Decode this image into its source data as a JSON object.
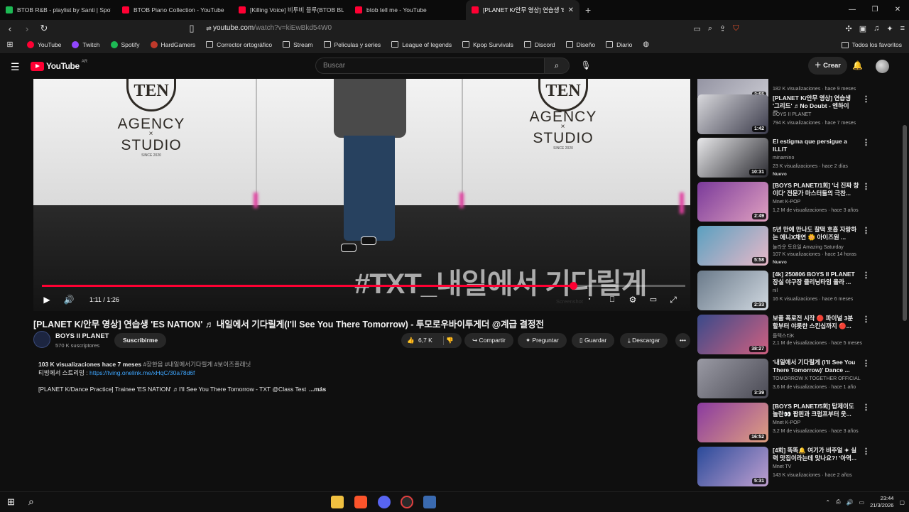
{
  "browser": {
    "tabs": [
      {
        "title": "BTOB R&B - playlist by Santi | Spotify",
        "color": "#1db954",
        "active": false
      },
      {
        "title": "BTOB Piano Collection - YouTube",
        "color": "#ff0033",
        "active": false
      },
      {
        "title": "[Killing Voice] 비투비 블루(BTOB BLU",
        "color": "#ff0033",
        "active": false
      },
      {
        "title": "btob tell me - YouTube",
        "color": "#ff0033",
        "active": false
      },
      {
        "title": "[PLANET K/안무 영상] 연습생 'ES",
        "color": "#ff0033",
        "active": true
      }
    ],
    "tab_close": "✕",
    "new_tab": "+",
    "window_controls": [
      "—",
      "❐",
      "✕"
    ],
    "url_host": "youtube.com",
    "url_path": "/watch?v=kiEwBkd54W0",
    "bookmarks": [
      {
        "label": "YouTube",
        "icon": "youtube-icon",
        "color": "#ff0033"
      },
      {
        "label": "Twitch",
        "icon": "twitch-icon",
        "color": "#9146ff"
      },
      {
        "label": "Spotify",
        "icon": "spotify-icon",
        "color": "#1db954"
      },
      {
        "label": "HardGamers",
        "icon": "hardgamers-icon",
        "color": "#c0392b"
      },
      {
        "label": "Corrector ortográfico",
        "icon": "spellcheck-icon",
        "color": ""
      },
      {
        "label": "Stream",
        "icon": "folder-icon",
        "color": ""
      },
      {
        "label": "Peliculas y series",
        "icon": "folder-icon",
        "color": ""
      },
      {
        "label": "League of legends",
        "icon": "folder-icon",
        "color": ""
      },
      {
        "label": "Kpop Survivals",
        "icon": "folder-icon",
        "color": ""
      },
      {
        "label": "Discord",
        "icon": "folder-icon",
        "color": ""
      },
      {
        "label": "Diseño",
        "icon": "folder-icon",
        "color": ""
      },
      {
        "label": "Diario",
        "icon": "folder-icon",
        "color": ""
      }
    ],
    "bookmarks_right": "Todos los favoritos"
  },
  "youtube": {
    "logo": "YouTube",
    "region": "AR",
    "search_placeholder": "Buscar",
    "create_label": "Crear",
    "accent": "#ff0033"
  },
  "player": {
    "wall_logo_top": "TEN",
    "wall_logo_mid": "AGENCY",
    "wall_logo_x": "×",
    "wall_logo_bottom": "STUDIO",
    "wall_logo_since": "SINCE 2020",
    "overlay_text": "#TXT_내일에서 기다릴게",
    "time": "1:11 / 1:26",
    "progress_fraction": 0.826,
    "screenshot_label": "Screenshot"
  },
  "video": {
    "title": "[PLANET K/안무 영상] 연습생 'ES NATION' ♬ 내일에서 기다릴게(I'll See You There Tomorrow) - 투모로우바이투게더 @계급 결정전",
    "channel": "BOYS II PLANET",
    "subscribers": "570 K suscriptores",
    "subscribe": "Suscribirme",
    "likes": "6,7 K",
    "share": "Compartir",
    "ask": "Preguntar",
    "save": "Guardar",
    "download": "Descargar",
    "desc_stats": "103 K visualizaciones  hace 7 meses",
    "desc_tags": "#장한음 #내일에서기다릴게 #보이즈플래닛",
    "desc_stream": "티빙에서 스트리밍 : ",
    "desc_link": "https://tving.onelink.me/xHqC/30a78d6f",
    "desc_line3": "[PLANET K/Dance Practice] Trainee 'ES NATION' ♬I'll See You There Tomorrow - TXT @Class Test",
    "desc_more": "...más"
  },
  "recommendations": [
    {
      "title": "",
      "channel": "",
      "views": "182 K visualizaciones · hace 9 meses",
      "duration": "2:55",
      "badge": "",
      "thumb": [
        "#8a8a9a",
        "#c8c8d0"
      ]
    },
    {
      "title": "[PLANET K/안무 영상] 연습생 '그리드' ♬No Doubt - 엔하이픈...",
      "channel": "BOYS II PLANET",
      "views": "794 K visualizaciones · hace 7 meses",
      "duration": "1:42",
      "badge": "",
      "thumb": [
        "#d8d8dc",
        "#3a3a4a"
      ]
    },
    {
      "title": "El estigma que persigue a ILLIT",
      "channel": "minamino",
      "views": "23 K visualizaciones · hace 2 días",
      "duration": "10:31",
      "badge": "Nuevo",
      "thumb": [
        "#e8e8ea",
        "#2a2a30"
      ]
    },
    {
      "title": "[BOYS PLANET/1회] '너 진짜 창이다' 전문가 마스터들의 극찬...",
      "channel": "Mnet K-POP",
      "views": "1,2 M de visualizaciones · hace 3 años",
      "duration": "2:49",
      "badge": "",
      "thumb": [
        "#7a3a9a",
        "#e0a0c0"
      ]
    },
    {
      "title": "5년 만에 만나도 찰떡 호흡 자랑하는 에니X채연 🌼 아이즈원 ...",
      "channel": "놀라운 토요일 Amazing Saturday",
      "views": "107 K visualizaciones · hace 14 horas",
      "duration": "5:58",
      "badge": "Nuevo",
      "thumb": [
        "#5aa0c0",
        "#e8b8c8"
      ]
    },
    {
      "title": "[4k] 250806 BOYS II PLANET 장실 야구장 클리닝타임 올라 ...",
      "channel": "nil",
      "views": "16 K visualizaciones · hace 6 meses",
      "duration": "2:33",
      "badge": "",
      "thumb": [
        "#6a7a8a",
        "#d0d8e0"
      ]
    },
    {
      "title": "보플 폭로전 시작 🔴 파이널 3분 할부터 야릇한 스킨십까지 🔴...",
      "channel": "돌텍스타K",
      "views": "2,1 M de visualizaciones · hace 5 meses",
      "duration": "38:27",
      "badge": "",
      "thumb": [
        "#3a4a8a",
        "#d06080"
      ]
    },
    {
      "title": "'내일에서 기다릴게 (I'll See You There Tomorrow)' Dance ...",
      "channel": "TOMORROW X TOGETHER OFFICIAL",
      "views": "3,6 M de visualizaciones · hace 1 año",
      "duration": "3:39",
      "badge": "",
      "thumb": [
        "#9a9aa4",
        "#4a4a54"
      ]
    },
    {
      "title": "[BOYS PLANET/5회] 탑제이도 놀란👀 팝핀과 크럼프부터 웃...",
      "channel": "Mnet K-POP",
      "views": "3,2 M de visualizaciones · hace 3 años",
      "duration": "16:52",
      "badge": "",
      "thumb": [
        "#8a3aa0",
        "#e0a080"
      ]
    },
    {
      "title": "[4회] 똑똑🔔 여기가 비주얼 ✦ 실력 맛집이라는데 맞나요?! '아역...",
      "channel": "Mnet TV",
      "views": "143 K visualizaciones · hace 2 años",
      "duration": "5:31",
      "badge": "",
      "thumb": [
        "#2a4a9a",
        "#c0a0d0"
      ]
    }
  ],
  "taskbar": {
    "time": "23:44",
    "date": "21/3/2026"
  }
}
